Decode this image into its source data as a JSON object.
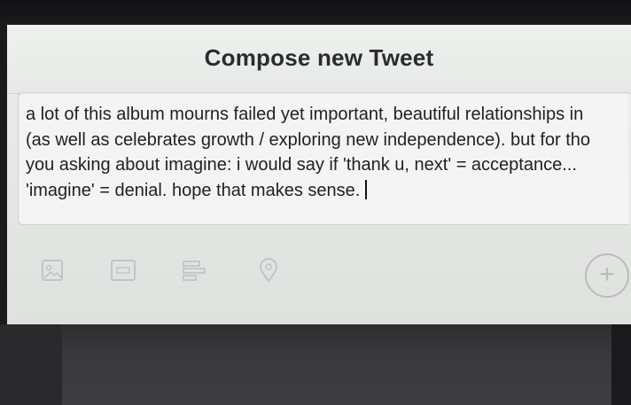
{
  "modal": {
    "title": "Compose new Tweet"
  },
  "compose": {
    "lines": [
      "a lot of this album mourns failed yet important, beautiful relationships in",
      "(as well as celebrates growth / exploring new independence). but for tho",
      "you asking about imagine: i would say if 'thank u, next' = acceptance...",
      "'imagine' = denial. hope that makes sense."
    ]
  },
  "toolbar": {
    "icons": [
      "image-icon",
      "gif-icon",
      "poll-icon",
      "location-icon",
      "add-tweet-icon"
    ],
    "add_symbol": "+"
  },
  "colors": {
    "modal_bg": "#e6e8e6",
    "text": "#1e2022",
    "icon": "#a9adb0"
  }
}
